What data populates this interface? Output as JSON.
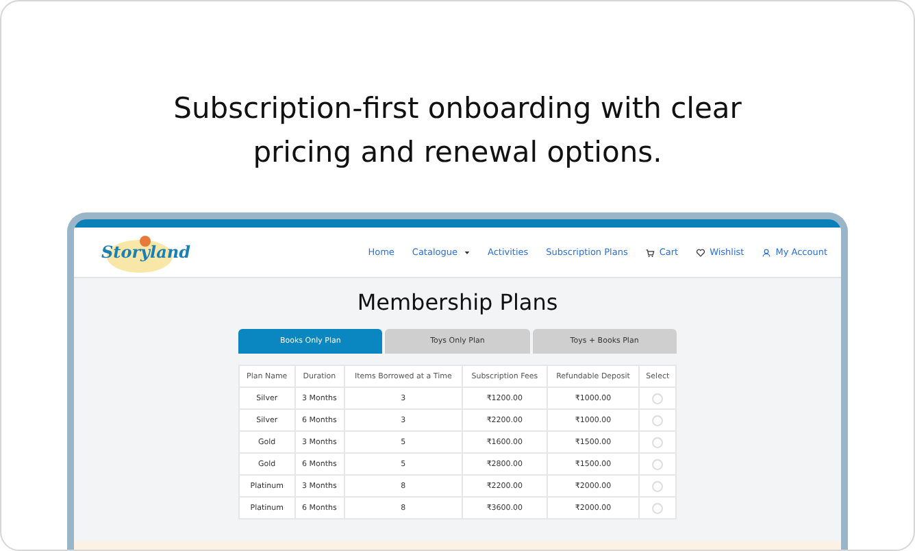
{
  "headline": "Subscription-first onboarding with clear pricing and renewal options.",
  "logo": {
    "name": "Storyland"
  },
  "nav": [
    {
      "label": "Home",
      "kind": "link"
    },
    {
      "label": "Catalogue",
      "kind": "dropdown"
    },
    {
      "label": "Activities",
      "kind": "link"
    },
    {
      "label": "Subscription Plans",
      "kind": "link"
    },
    {
      "label": "Cart",
      "kind": "cart"
    },
    {
      "label": "Wishlist",
      "kind": "heart"
    },
    {
      "label": "My Account",
      "kind": "user"
    }
  ],
  "title": "Membership Plans",
  "tabs": [
    {
      "label": "Books Only Plan",
      "selected": true
    },
    {
      "label": "Toys Only Plan",
      "selected": false
    },
    {
      "label": "Toys + Books Plan",
      "selected": false
    }
  ],
  "table": {
    "columns": [
      "Plan Name",
      "Duration",
      "Items Borrowed at a Time",
      "Subscription Fees",
      "Refundable Deposit",
      "Select"
    ],
    "rows": [
      {
        "cells": [
          "Silver",
          "3 Months",
          "3",
          "₹1200.00",
          "₹1000.00"
        ],
        "selected": false
      },
      {
        "cells": [
          "Silver",
          "6 Months",
          "3",
          "₹2200.00",
          "₹1000.00"
        ],
        "selected": false
      },
      {
        "cells": [
          "Gold",
          "3 Months",
          "5",
          "₹1600.00",
          "₹1500.00"
        ],
        "selected": false
      },
      {
        "cells": [
          "Gold",
          "6 Months",
          "5",
          "₹2800.00",
          "₹1500.00"
        ],
        "selected": false
      },
      {
        "cells": [
          "Platinum",
          "3 Months",
          "8",
          "₹2200.00",
          "₹2000.00"
        ],
        "selected": false
      },
      {
        "cells": [
          "Platinum",
          "6 Months",
          "8",
          "₹3600.00",
          "₹2000.00"
        ],
        "selected": false
      }
    ]
  }
}
